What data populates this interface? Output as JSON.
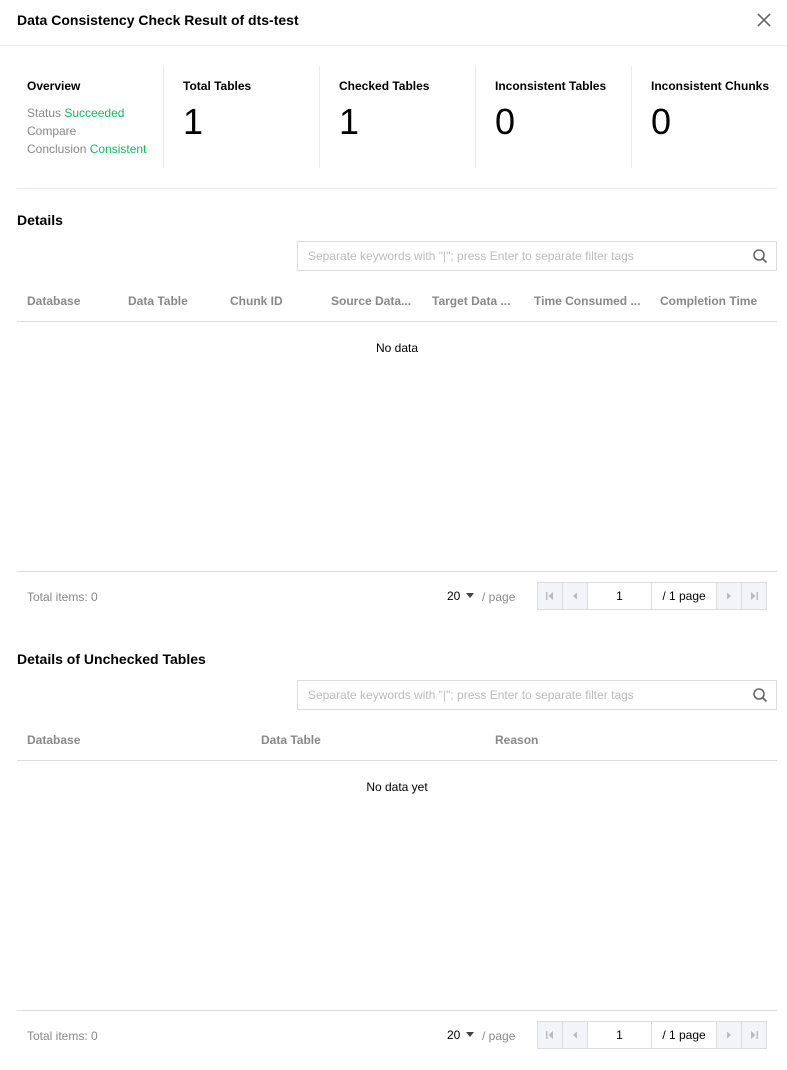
{
  "dialog": {
    "title": "Data Consistency Check Result of dts-test"
  },
  "overview": {
    "label": "Overview",
    "status_label": "Status",
    "status_value": "Succeeded",
    "compare_label": "Compare",
    "conclusion_label": "Conclusion",
    "conclusion_value": "Consistent",
    "stats": [
      {
        "label": "Total Tables",
        "value": "1"
      },
      {
        "label": "Checked Tables",
        "value": "1"
      },
      {
        "label": "Inconsistent Tables",
        "value": "0"
      },
      {
        "label": "Inconsistent Chunks",
        "value": "0"
      }
    ]
  },
  "details": {
    "title": "Details",
    "search_placeholder": "Separate keywords with \"|\"; press Enter to separate filter tags",
    "columns": [
      "Database",
      "Data Table",
      "Chunk ID",
      "Source Data...",
      "Target Data ...",
      "Time Consumed ...",
      "Completion Time"
    ],
    "empty_text": "No data",
    "total_items": "Total items:  0",
    "page_size": "20",
    "per_page": "/ page",
    "current_page": "1",
    "total_pages": "/ 1 page"
  },
  "unchecked": {
    "title": "Details of Unchecked Tables",
    "search_placeholder": "Separate keywords with \"|\"; press Enter to separate filter tags",
    "columns": [
      "Database",
      "Data Table",
      "Reason"
    ],
    "empty_text": "No data yet",
    "total_items": "Total items:  0",
    "page_size": "20",
    "per_page": "/ page",
    "current_page": "1",
    "total_pages": "/ 1 page"
  },
  "colors": {
    "success": "#0abf5b",
    "muted": "#888888",
    "border": "#dcdcdc"
  }
}
